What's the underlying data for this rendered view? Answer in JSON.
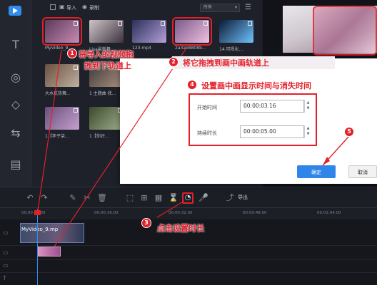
{
  "library": {
    "import_label": "导入",
    "record_label": "录制",
    "sort_value": "所有",
    "items": [
      {
        "caption": "MyVideo_9...",
        "colors": [
          "#5b3a5c",
          "#c98ab3"
        ]
      },
      {
        "caption": "Lisa最新舞...",
        "colors": [
          "#cfc5c8",
          "#3d3340"
        ]
      },
      {
        "caption": "123.mp4",
        "colors": [
          "#2a2f5a",
          "#b4a0d8"
        ]
      },
      {
        "caption": "2a3ab8808b...",
        "colors": [
          "#7c5a8b",
          "#f0c0e0"
        ]
      },
      {
        "caption": "14.可视化...",
        "colors": [
          "#0d1a35",
          "#6ec3ff"
        ]
      },
      {
        "caption": "大水坑热舞...",
        "colors": [
          "#6a5040",
          "#c0b0a0"
        ]
      },
      {
        "caption": "1 主题曲 我...",
        "colors": [
          "#3b3b3b",
          "#b09080"
        ]
      },
      {
        "caption": "1【李子柒...",
        "colors": [
          "#6a4f7a",
          "#c5a0d0"
        ]
      },
      {
        "caption": "1【你好...",
        "colors": [
          "#3a4a2a",
          "#a0b090"
        ]
      }
    ]
  },
  "timeline": {
    "export_label": "导出",
    "ruler": [
      "00:00:00.00",
      "00:00:16.00",
      "00:00:32.00",
      "00:00:48.00",
      "00:01:04.00"
    ],
    "clip1_label": "MyVideo_9.mp"
  },
  "dialog": {
    "start_label": "开始时间",
    "start_value": "00:00:03.16",
    "duration_label": "持续时长",
    "duration_value": "00:00:05.00",
    "ok_label": "确定",
    "cancel_label": "取消"
  },
  "annotations": {
    "step1": {
      "num": "1",
      "text1": "将导入的视频拖",
      "text2": "拽到下轨道上"
    },
    "step2": {
      "num": "2",
      "text": "将它拖拽到画中画轨道上"
    },
    "step3": {
      "num": "3",
      "text": "点击设置时长"
    },
    "step4": {
      "num": "4",
      "text": "设置画中画显示时间与消失时间"
    },
    "step5": {
      "num": "5"
    }
  },
  "colors": {
    "accent": "#2f86e8",
    "annotation": "#e3202a"
  }
}
